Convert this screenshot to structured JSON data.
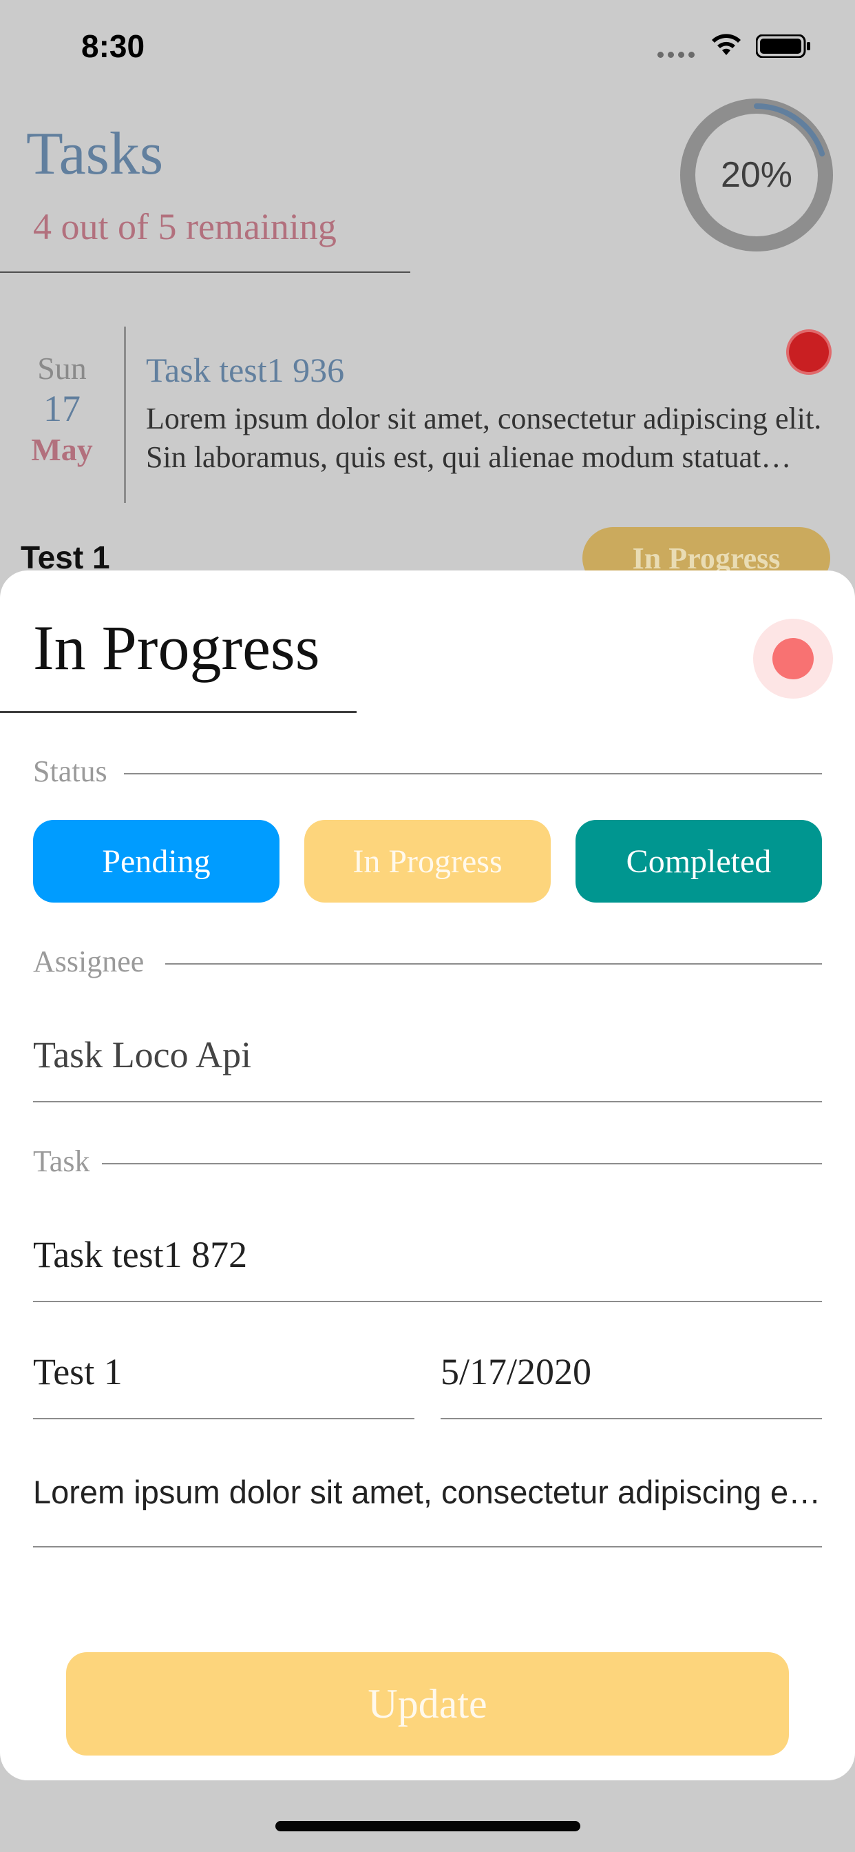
{
  "status_bar": {
    "time": "8:30"
  },
  "header": {
    "title": "Tasks",
    "subtitle": "4 out of 5 remaining",
    "progress_text": "20%",
    "progress_fraction": 0.2
  },
  "task_card": {
    "day": "Sun",
    "date": "17",
    "month": "May",
    "title": "Task test1 936",
    "description": "Lorem ipsum dolor sit amet, consectetur adipiscing elit. Sin laboramus, quis est, qui alienae modum statuat industriae?",
    "label": "Test 1",
    "status": "In Progress"
  },
  "sheet": {
    "title": "In Progress",
    "status_section_label": "Status",
    "status_options": [
      "Pending",
      "In Progress",
      "Completed"
    ],
    "assignee_section_label": "Assignee",
    "assignee_value": "Task Loco Api",
    "task_section_label": "Task",
    "task_value": "Task test1 872",
    "test_value": "Test 1",
    "date_value": "5/17/2020",
    "description_value": "Lorem ipsum dolor sit amet, consectetur adipiscing elit. Sin laboramus, quis est, qui alienae modum statuat industriae?",
    "update_label": "Update"
  },
  "colors": {
    "pending": "#009cff",
    "in_progress": "#fdd57c",
    "completed": "#009690",
    "title_blue": "#617f9e",
    "accent_pink": "#b2707d"
  }
}
